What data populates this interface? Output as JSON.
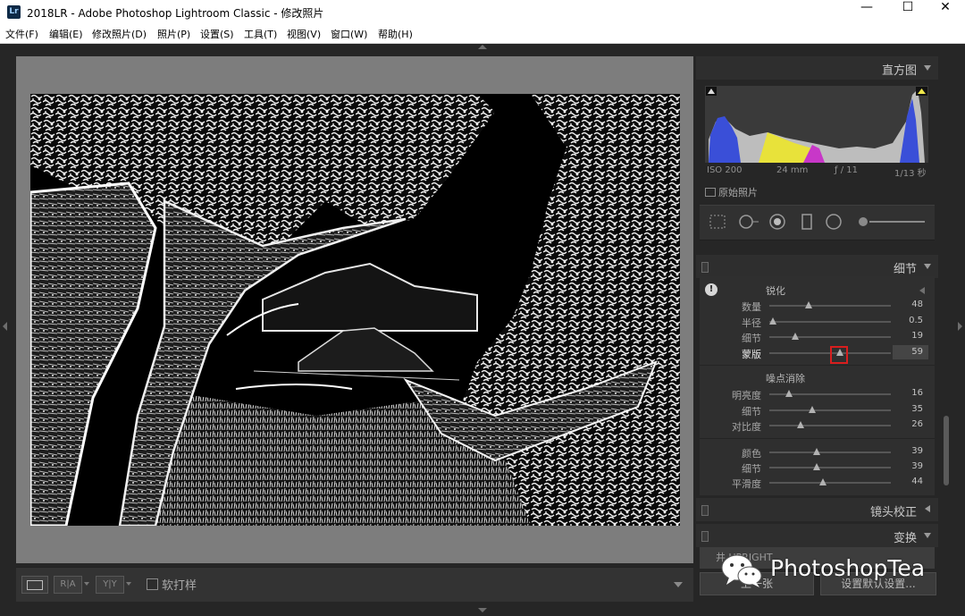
{
  "window": {
    "app_icon_text": "Lr",
    "title": "2018LR - Adobe Photoshop Lightroom Classic - 修改照片",
    "minimize_glyph": "—",
    "maximize_glyph": "☐",
    "close_glyph": "✕"
  },
  "menu": {
    "items": [
      "文件(F)",
      "编辑(E)",
      "修改照片(D)",
      "照片(P)",
      "设置(S)",
      "工具(T)",
      "视图(V)",
      "窗口(W)",
      "帮助(H)"
    ]
  },
  "toolbar": {
    "view_mode_icon": "loupe-view-icon",
    "before_after_label": "R|A",
    "yy_label": "Y|Y",
    "softproof_label": "软打样",
    "softproof_checked": false
  },
  "histogram": {
    "header": "直方图",
    "iso": "ISO 200",
    "focal": "24 mm",
    "aperture": "ƒ / 11",
    "shutter": "1/13 秒",
    "original_photo_label": "原始照片",
    "colors": {
      "blue": "#3a4fd8",
      "yellow": "#e8e23a",
      "magenta": "#c837c8",
      "gray": "#bdbdbd"
    }
  },
  "detail": {
    "header": "细节",
    "sharpening": {
      "title": "锐化",
      "sliders": [
        {
          "label": "数量",
          "value": "48",
          "fraction": 0.32
        },
        {
          "label": "半径",
          "value": "0.5",
          "fraction": 0.03
        },
        {
          "label": "细节",
          "value": "19",
          "fraction": 0.21
        },
        {
          "label": "蒙版",
          "value": "59",
          "fraction": 0.58,
          "active": true
        }
      ]
    },
    "noise_reduction": {
      "title": "噪点消除",
      "luminance": [
        {
          "label": "明亮度",
          "value": "16",
          "fraction": 0.16
        },
        {
          "label": "细节",
          "value": "35",
          "fraction": 0.35
        },
        {
          "label": "对比度",
          "value": "26",
          "fraction": 0.26
        }
      ],
      "color": [
        {
          "label": "颜色",
          "value": "39",
          "fraction": 0.39
        },
        {
          "label": "细节",
          "value": "39",
          "fraction": 0.39
        },
        {
          "label": "平滑度",
          "value": "44",
          "fraction": 0.44
        }
      ]
    }
  },
  "lens_panel": {
    "header": "镜头校正"
  },
  "transform_panel": {
    "header": "变换",
    "peek_text": "井  UPRIGHT"
  },
  "bottom_buttons": {
    "previous": "上一张",
    "reset_default": "设置默认设置..."
  },
  "watermark": {
    "text": "PhotoshopTea"
  }
}
